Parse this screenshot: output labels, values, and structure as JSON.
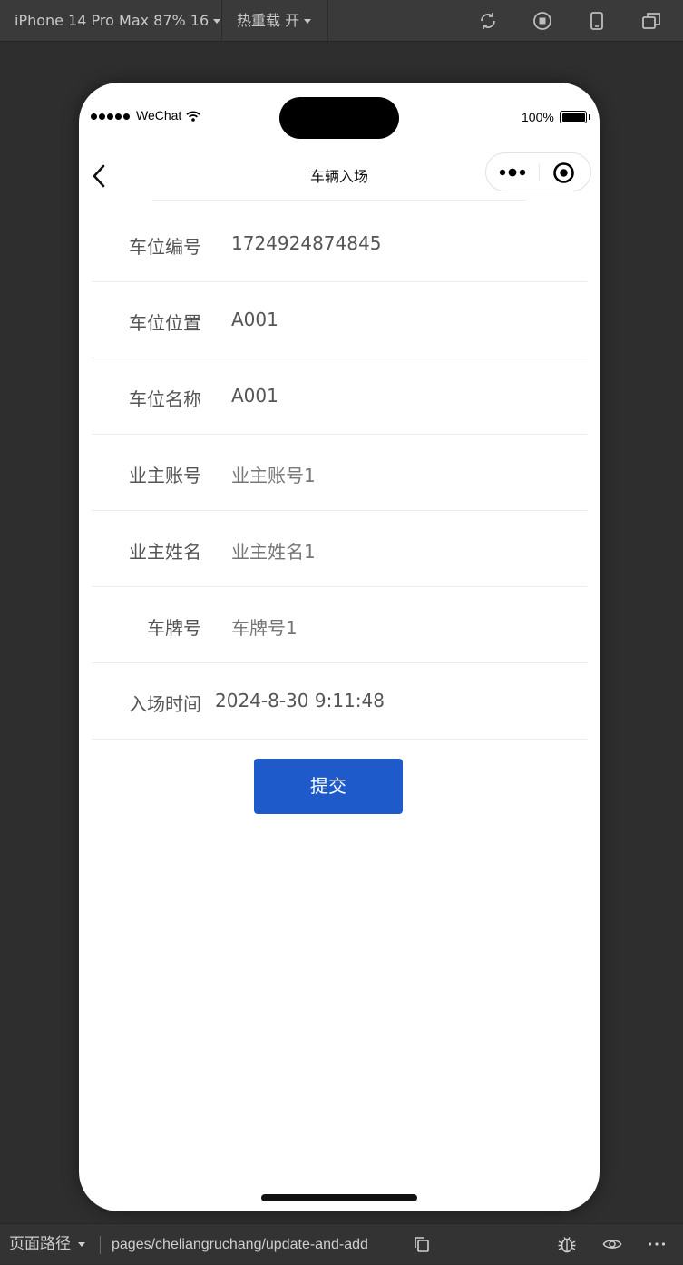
{
  "toolbar": {
    "device_label": "iPhone 14 Pro Max 87% 16",
    "hot_reload_label": "热重载 开",
    "icons": [
      "compile-icon",
      "stop-icon",
      "device-icon",
      "window-icon"
    ]
  },
  "status_bar": {
    "carrier": "WeChat",
    "battery": "100%"
  },
  "navbar": {
    "title": "车辆入场"
  },
  "form": {
    "rows": [
      {
        "label": "车位编号",
        "value": "1724924874845"
      },
      {
        "label": "车位位置",
        "value": "A001"
      },
      {
        "label": "车位名称",
        "value": "A001"
      },
      {
        "label": "业主账号",
        "value": "业主账号1"
      },
      {
        "label": "业主姓名",
        "value": "业主姓名1"
      },
      {
        "label": "车牌号",
        "value": "车牌号1"
      },
      {
        "label": "入场时间",
        "value": "2024-8-30 9:11:48"
      }
    ],
    "submit_label": "提交"
  },
  "bottombar": {
    "path_label": "页面路径",
    "path": "pages/cheliangruchang/update-and-add"
  },
  "colors": {
    "primary_button": "#1e5ac9",
    "ide_background": "#2e2e2e"
  }
}
